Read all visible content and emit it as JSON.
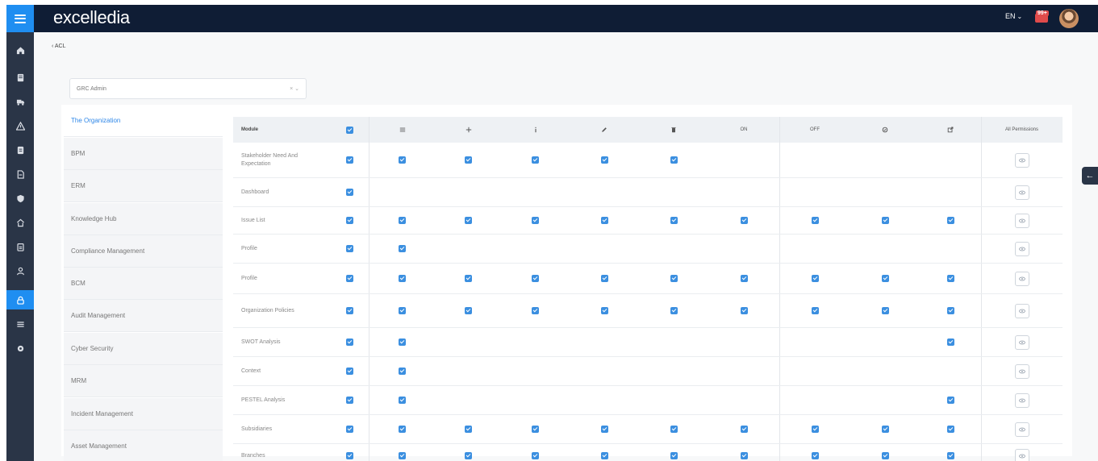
{
  "topbar": {
    "brand": "excelledia",
    "language": "EN",
    "notification_count": "99+"
  },
  "sidebar": {
    "items": [
      {
        "icon": "home-icon"
      },
      {
        "icon": "document-icon"
      },
      {
        "icon": "truck-icon"
      },
      {
        "icon": "warning-icon"
      },
      {
        "icon": "folder-icon"
      },
      {
        "icon": "file-icon"
      },
      {
        "icon": "shield-icon"
      },
      {
        "icon": "building-icon"
      },
      {
        "icon": "clipboard-icon"
      },
      {
        "icon": "user-icon"
      },
      {
        "icon": "lock-icon",
        "active": true
      },
      {
        "icon": "list-icon"
      },
      {
        "icon": "settings-icon"
      }
    ]
  },
  "breadcrumb": {
    "label": "ACL"
  },
  "role_select": {
    "value": "GRC Admin",
    "controls": "× ⌄"
  },
  "module_tabs": [
    {
      "label": "The Organization",
      "active": true
    },
    {
      "label": "BPM"
    },
    {
      "label": "ERM"
    },
    {
      "label": "Knowledge Hub"
    },
    {
      "label": "Compliance Management"
    },
    {
      "label": "BCM"
    },
    {
      "label": "Audit Management"
    },
    {
      "label": "Cyber Security"
    },
    {
      "label": "MRM"
    },
    {
      "label": "Incident Management"
    },
    {
      "label": "Asset Management"
    }
  ],
  "table": {
    "columns": [
      {
        "key": "module",
        "label": "Module"
      },
      {
        "key": "all",
        "icon": "checkbox-icon"
      },
      {
        "key": "list",
        "icon": "list-icon"
      },
      {
        "key": "add",
        "icon": "plus-icon"
      },
      {
        "key": "info",
        "icon": "info-icon"
      },
      {
        "key": "edit",
        "icon": "pencil-icon"
      },
      {
        "key": "delete",
        "icon": "trash-icon"
      },
      {
        "key": "on",
        "label": "ON"
      },
      {
        "key": "off",
        "label": "OFF"
      },
      {
        "key": "approve",
        "icon": "approve-icon"
      },
      {
        "key": "export",
        "icon": "export-icon"
      },
      {
        "key": "all_permissions",
        "label": "All Permissions"
      }
    ],
    "rows": [
      {
        "module": "Stakeholder Need And Expectation",
        "checks": [
          true,
          true,
          true,
          true,
          true,
          true,
          false,
          false,
          false,
          false
        ]
      },
      {
        "module": "Dashboard",
        "checks": [
          true,
          false,
          false,
          false,
          false,
          false,
          false,
          false,
          false,
          false
        ]
      },
      {
        "module": "Issue List",
        "checks": [
          true,
          true,
          true,
          true,
          true,
          true,
          true,
          true,
          true,
          true
        ]
      },
      {
        "module": "Profile",
        "checks": [
          true,
          true,
          false,
          false,
          false,
          false,
          false,
          false,
          false,
          false
        ]
      },
      {
        "module": "Profile",
        "checks": [
          true,
          true,
          true,
          true,
          true,
          true,
          true,
          true,
          true,
          true
        ]
      },
      {
        "module": "Organization Policies",
        "checks": [
          true,
          true,
          true,
          true,
          true,
          true,
          true,
          true,
          true,
          true
        ]
      },
      {
        "module": "SWOT Analysis",
        "checks": [
          true,
          true,
          false,
          false,
          false,
          false,
          false,
          false,
          false,
          true
        ]
      },
      {
        "module": "Context",
        "checks": [
          true,
          true,
          false,
          false,
          false,
          false,
          false,
          false,
          false,
          false
        ]
      },
      {
        "module": "PESTEL Analysis",
        "checks": [
          true,
          true,
          false,
          false,
          false,
          false,
          false,
          false,
          false,
          true
        ]
      },
      {
        "module": "Subsidiaries",
        "checks": [
          true,
          true,
          true,
          true,
          true,
          true,
          true,
          true,
          true,
          true
        ]
      },
      {
        "module": "Branches",
        "checks": [
          true,
          true,
          true,
          true,
          true,
          true,
          true,
          true,
          true,
          true
        ]
      }
    ]
  },
  "colors": {
    "topbar": "#0f1d35",
    "sidebar": "#2a3547",
    "accent": "#1f8ef1",
    "checkbox": "#3b8fe0",
    "active_tab_text": "#2e87e8"
  }
}
